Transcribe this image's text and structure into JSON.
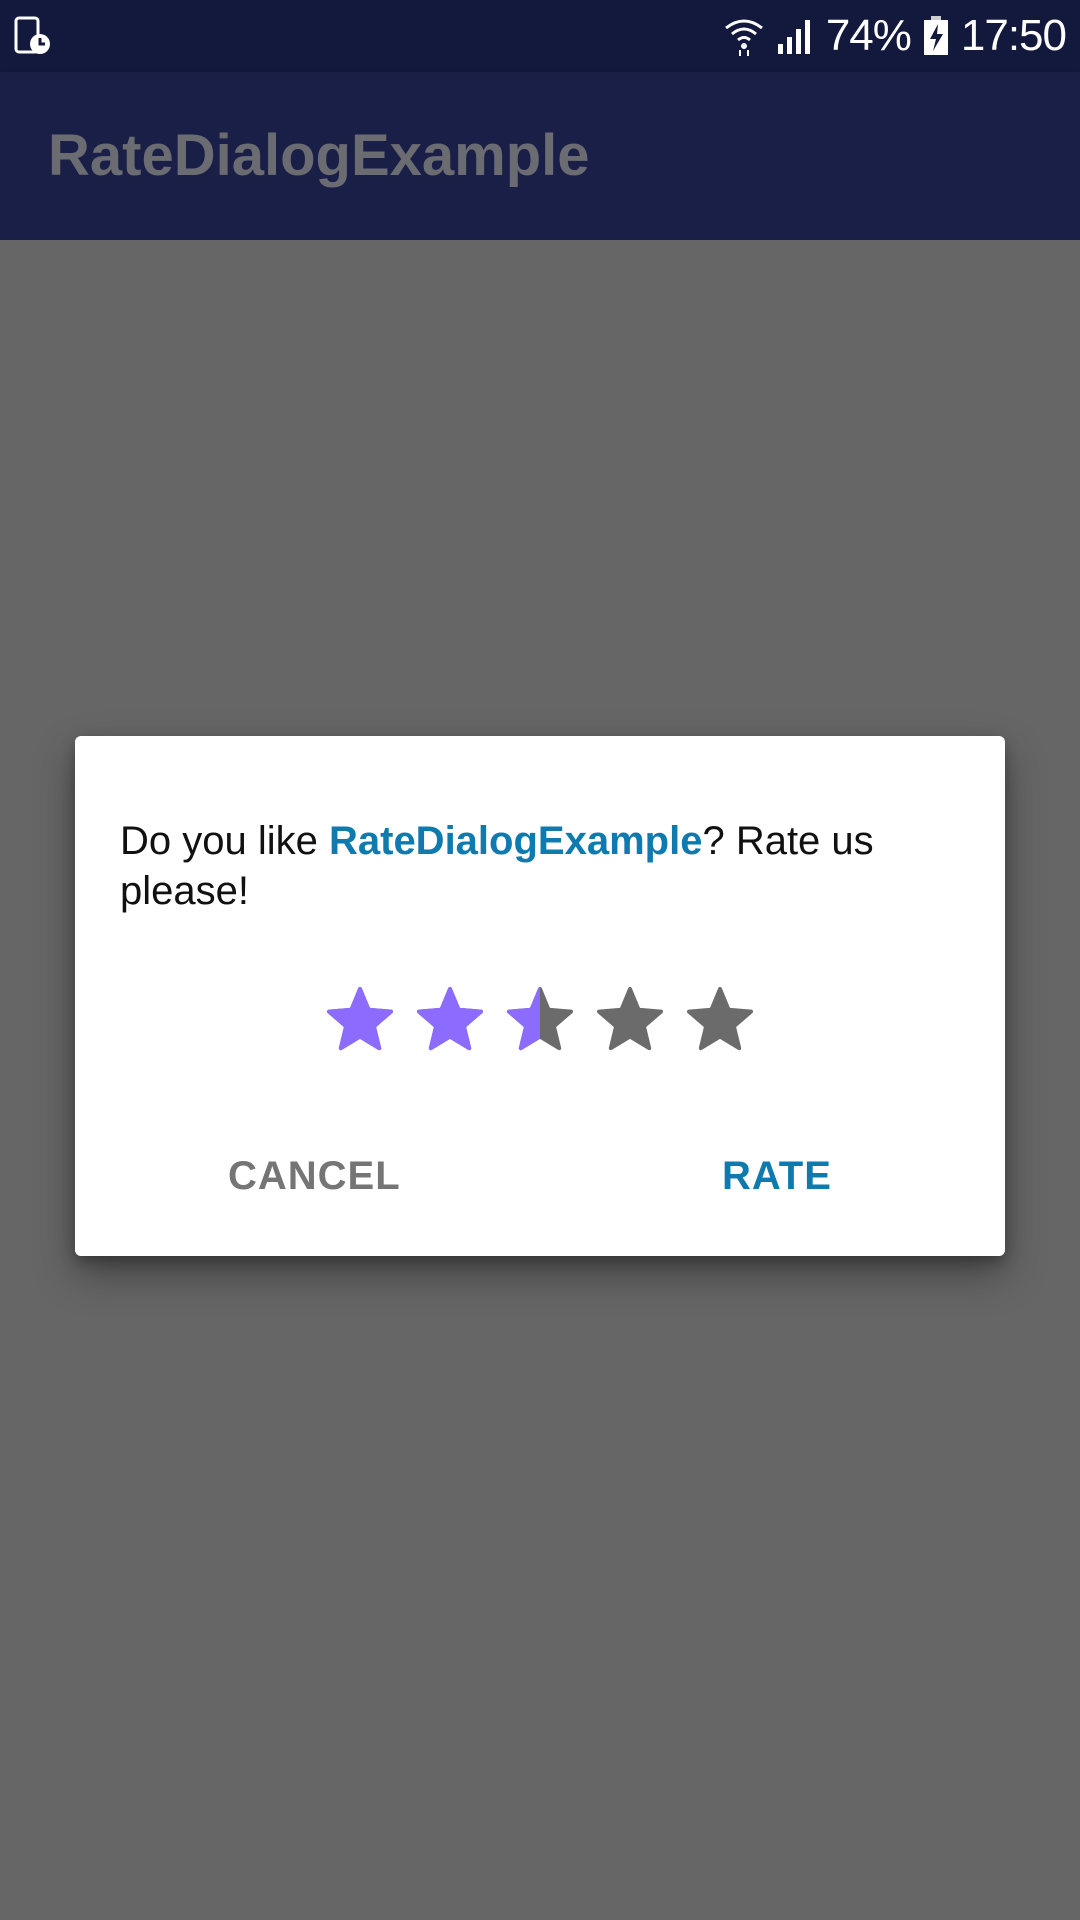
{
  "status_bar": {
    "battery_percent": "74%",
    "time": "17:50",
    "icons": [
      "screen-recorder-icon",
      "wifi-icon",
      "cell-signal-icon",
      "battery-charging-icon"
    ]
  },
  "app_bar": {
    "title": "RateDialogExample"
  },
  "dialog": {
    "message_prefix": "Do you like ",
    "app_name": "RateDialogExample",
    "message_suffix": "? Rate us please!",
    "rating": {
      "value": 2.5,
      "max": 5,
      "filled_color": "#8c6bff",
      "empty_color": "#6b6b6b"
    },
    "cancel_label": "CANCEL",
    "rate_label": "RATE"
  },
  "colors": {
    "status_bar": "#13183d",
    "app_bar": "#1a1f48",
    "scrim": "#666666",
    "accent": "#0f7aae"
  }
}
